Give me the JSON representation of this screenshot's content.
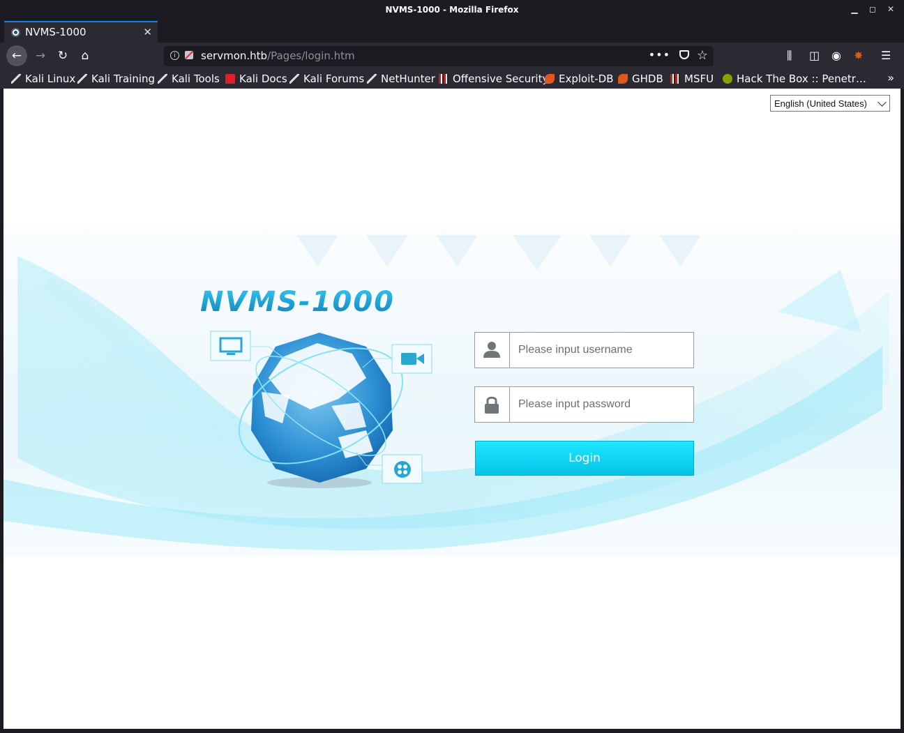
{
  "window": {
    "title": "NVMS-1000 - Mozilla Firefox"
  },
  "tabs": [
    {
      "label": "NVMS-1000"
    }
  ],
  "urlbar": {
    "host": "servmon.htb",
    "path": "/Pages/login.htm"
  },
  "bookmarks": [
    {
      "label": "Kali Linux",
      "icon": "kali-dragon-icon"
    },
    {
      "label": "Kali Training",
      "icon": "kali-dragon-icon"
    },
    {
      "label": "Kali Tools",
      "icon": "kali-dragon-icon"
    },
    {
      "label": "Kali Docs",
      "icon": "kali-docs-icon"
    },
    {
      "label": "Kali Forums",
      "icon": "kali-dragon-icon"
    },
    {
      "label": "NetHunter",
      "icon": "kali-dragon-icon"
    },
    {
      "label": "Offensive Security",
      "icon": "offsec-icon"
    },
    {
      "label": "Exploit-DB",
      "icon": "exploit-db-icon"
    },
    {
      "label": "GHDB",
      "icon": "exploit-db-icon"
    },
    {
      "label": "MSFU",
      "icon": "offsec-icon"
    },
    {
      "label": "Hack The Box :: Penetr…",
      "icon": "htb-icon"
    }
  ],
  "page": {
    "language": "English (United States)",
    "logo_text": "NVMS-1000",
    "username_placeholder": "Please input username",
    "password_placeholder": "Please input password",
    "login_label": "Login"
  },
  "colors": {
    "accent": "#0a84ff",
    "login_button": "#06c3e6",
    "logo": "#1aa6d8"
  }
}
